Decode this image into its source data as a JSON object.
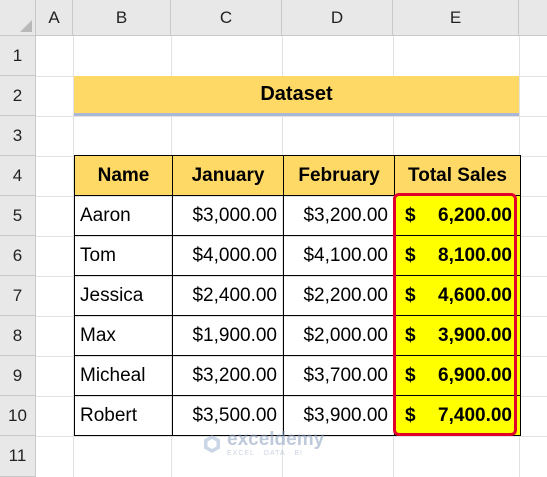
{
  "columns": [
    "A",
    "B",
    "C",
    "D",
    "E"
  ],
  "rows": [
    "1",
    "2",
    "3",
    "4",
    "5",
    "6",
    "7",
    "8",
    "9",
    "10",
    "11"
  ],
  "title": "Dataset",
  "table": {
    "headers": [
      "Name",
      "January",
      "February",
      "Total Sales"
    ],
    "rows": [
      {
        "name": "Aaron",
        "jan": "$3,000.00",
        "feb": "$3,200.00",
        "cur": "$",
        "total": "6,200.00"
      },
      {
        "name": "Tom",
        "jan": "$4,000.00",
        "feb": "$4,100.00",
        "cur": "$",
        "total": "8,100.00"
      },
      {
        "name": "Jessica",
        "jan": "$2,400.00",
        "feb": "$2,200.00",
        "cur": "$",
        "total": "4,600.00"
      },
      {
        "name": "Max",
        "jan": "$1,900.00",
        "feb": "$2,000.00",
        "cur": "$",
        "total": "3,900.00"
      },
      {
        "name": "Micheal",
        "jan": "$3,200.00",
        "feb": "$3,700.00",
        "cur": "$",
        "total": "6,900.00"
      },
      {
        "name": "Robert",
        "jan": "$3,500.00",
        "feb": "$3,900.00",
        "cur": "$",
        "total": "7,400.00"
      }
    ]
  },
  "watermark": {
    "brand": "exceldemy",
    "tagline": "EXCEL · DATA · BI"
  },
  "colors": {
    "header_fill": "#ffd966",
    "total_fill": "#ffff00",
    "highlight_border": "#e0002a"
  }
}
